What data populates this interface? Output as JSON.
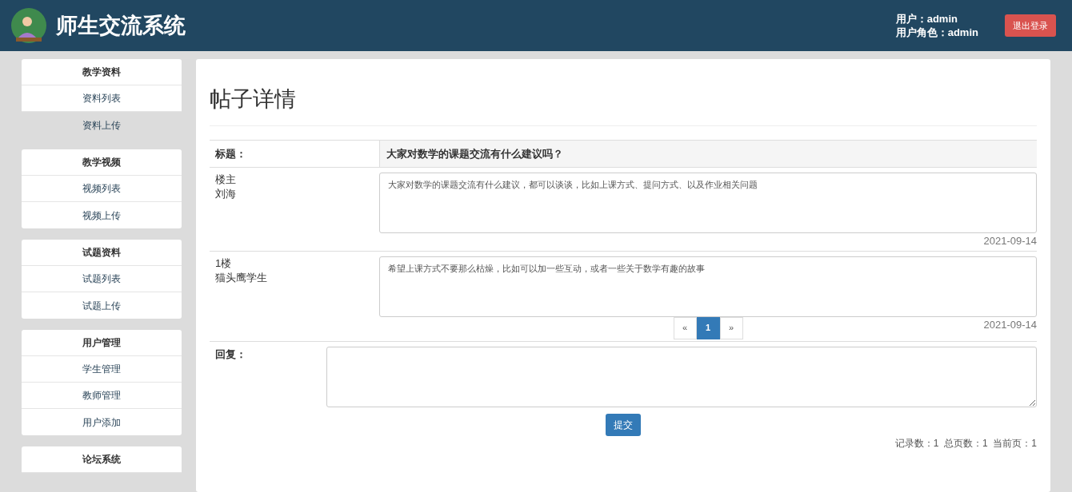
{
  "header": {
    "title": "师生交流系统",
    "user": "用户：admin",
    "role": "用户角色：admin",
    "logout": "退出登录"
  },
  "sidebar": [
    {
      "heading": "教学资料",
      "items": [
        {
          "label": "资料列表",
          "selected": false
        },
        {
          "label": "资料上传",
          "selected": true
        }
      ]
    },
    {
      "heading": "教学视频",
      "items": [
        {
          "label": "视频列表",
          "selected": false
        },
        {
          "label": "视频上传",
          "selected": false
        }
      ]
    },
    {
      "heading": "试题资料",
      "items": [
        {
          "label": "试题列表",
          "selected": false
        },
        {
          "label": "试题上传",
          "selected": false
        }
      ]
    },
    {
      "heading": "用户管理",
      "items": [
        {
          "label": "学生管理",
          "selected": false
        },
        {
          "label": "教师管理",
          "selected": false
        },
        {
          "label": "用户添加",
          "selected": false
        }
      ]
    },
    {
      "heading": "论坛系统"
    }
  ],
  "page_title": "帖子详情",
  "post": {
    "title_label": "标题：",
    "title": "大家对数学的课题交流有什么建议吗？",
    "replies": [
      {
        "floor": "楼主",
        "author": "刘海",
        "content": "大家对数学的课题交流有什么建议，都可以谈谈，比如上课方式、提问方式、以及作业相关问题",
        "date": "2021-09-14"
      },
      {
        "floor": "1楼",
        "author": "猫头鹰学生",
        "content": "希望上课方式不要那么枯燥，比如可以加一些互动，或者一些关于数学有趣的故事",
        "date": "2021-09-14"
      }
    ]
  },
  "pagination": [
    {
      "label": "«",
      "selected": false
    },
    {
      "label": "1",
      "selected": true
    },
    {
      "label": "»",
      "selected": false
    }
  ],
  "reply_form": {
    "label": "回复：",
    "submit": "提交"
  },
  "footer": "记录数：1  总页数：1  当前页：1"
}
